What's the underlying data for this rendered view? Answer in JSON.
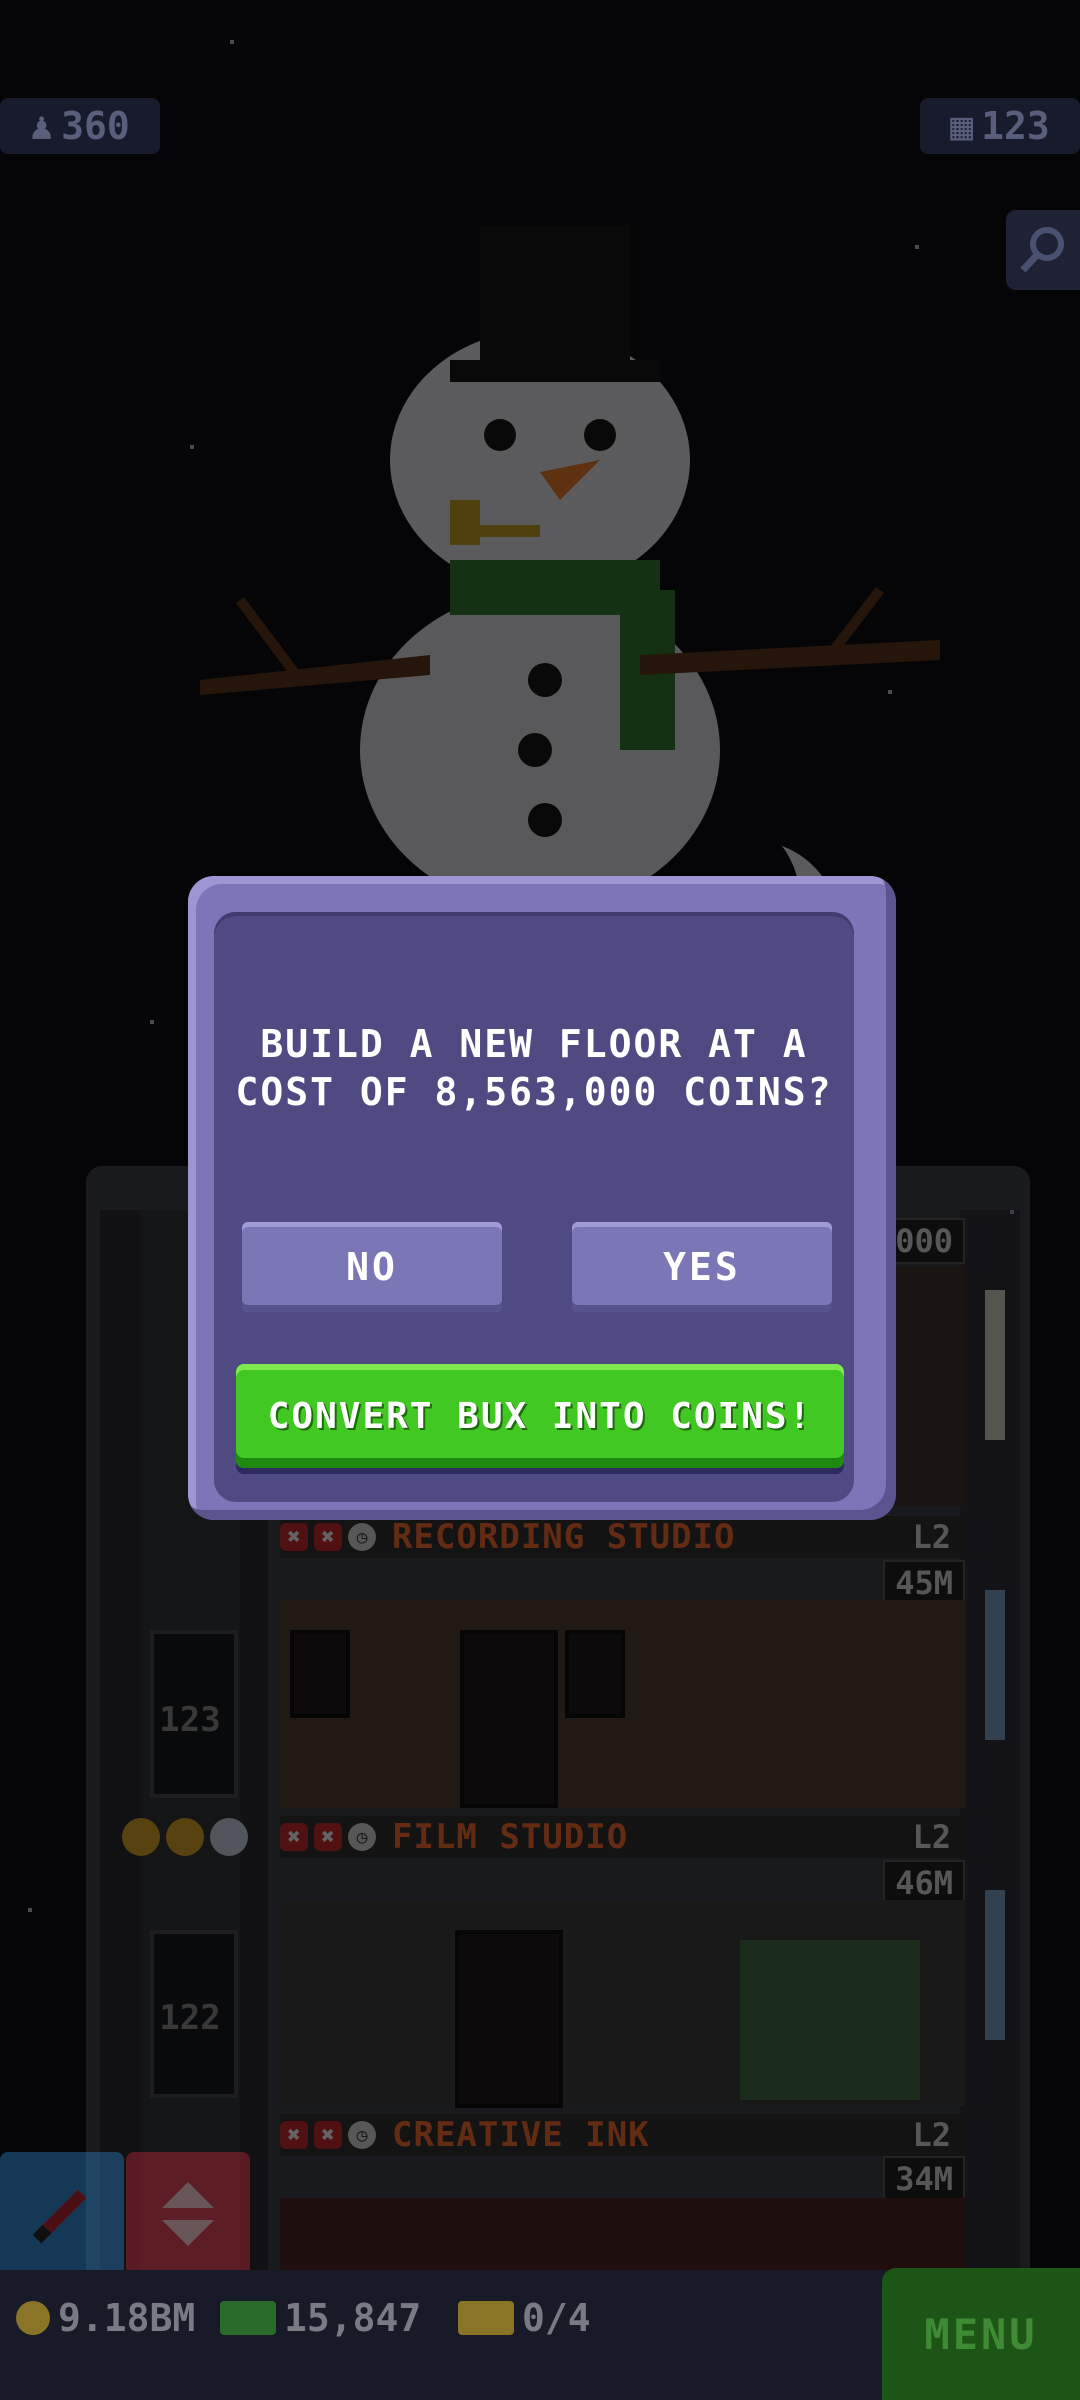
{
  "top_bar": {
    "population": "360",
    "population_icon": "person-icon",
    "floors": "123",
    "floors_icon": "building-icon",
    "search_icon": "magnifier-icon"
  },
  "dialog": {
    "message": "BUILD A NEW FLOOR AT A\nCOST OF 8,563,000 COINS?",
    "no_label": "NO",
    "yes_label": "YES",
    "convert_label": "CONVERT BUX INTO COINS!"
  },
  "tower": {
    "top_floor_tag": "000",
    "floors": [
      {
        "name": "RECORDING STUDIO",
        "level": "L2",
        "income": "45M",
        "number": "123"
      },
      {
        "name": "FILM STUDIO",
        "level": "L2",
        "income": "46M",
        "number": "122"
      },
      {
        "name": "CREATIVE INK",
        "level": "L2",
        "income": "34M",
        "number": ""
      }
    ]
  },
  "bottom_bar": {
    "coins": "9.18BM",
    "bux": "15,847",
    "tickets": "0/4",
    "menu_label": "MENU"
  },
  "colors": {
    "dialog_frame": "#7d75b8",
    "dialog_fill": "#4f4b82",
    "button": "#7b76b6",
    "convert_button": "#42c822",
    "floor_name": "#ff6a28"
  }
}
